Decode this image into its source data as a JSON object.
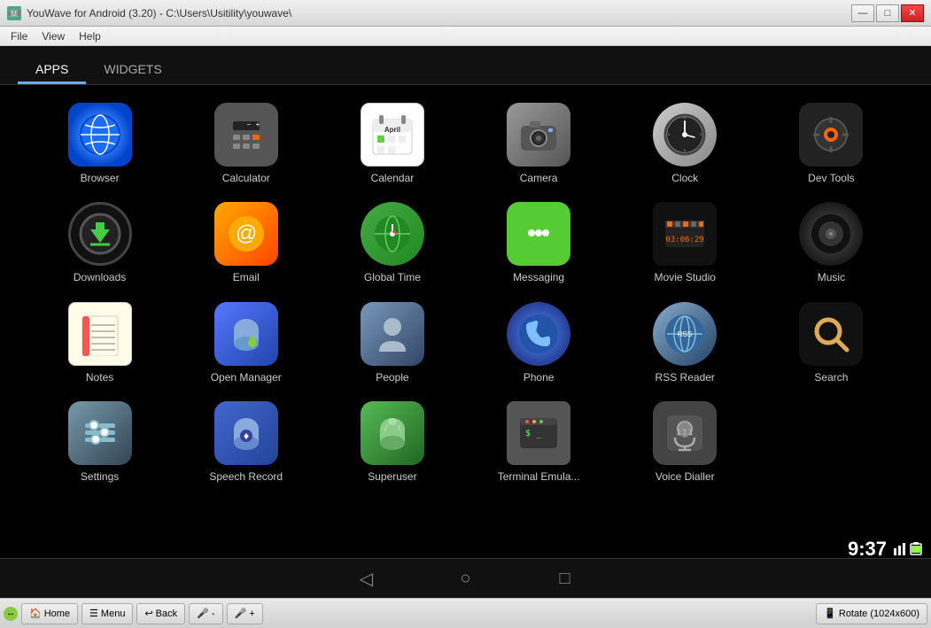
{
  "window": {
    "title": "YouWave for Android (3.20) - C:\\Users\\Usitility\\youwave\\",
    "icon": "🤖",
    "controls": {
      "minimize": "—",
      "maximize": "□",
      "close": "✕"
    }
  },
  "menubar": {
    "items": [
      "File",
      "View",
      "Help"
    ]
  },
  "tabs": [
    {
      "id": "apps",
      "label": "APPS",
      "active": true
    },
    {
      "id": "widgets",
      "label": "WIDGETS",
      "active": false
    }
  ],
  "apps": [
    {
      "id": "browser",
      "label": "Browser",
      "icon": "🌐",
      "iconClass": "icon-browser"
    },
    {
      "id": "calculator",
      "label": "Calculator",
      "icon": "🔢",
      "iconClass": "icon-calculator"
    },
    {
      "id": "calendar",
      "label": "Calendar",
      "icon": "📅",
      "iconClass": "icon-calendar"
    },
    {
      "id": "camera",
      "label": "Camera",
      "icon": "📷",
      "iconClass": "icon-camera"
    },
    {
      "id": "clock",
      "label": "Clock",
      "icon": "🕐",
      "iconClass": "icon-clock"
    },
    {
      "id": "devtools",
      "label": "Dev Tools",
      "icon": "⚙",
      "iconClass": "icon-devtools"
    },
    {
      "id": "downloads",
      "label": "Downloads",
      "icon": "⬇",
      "iconClass": "icon-downloads"
    },
    {
      "id": "email",
      "label": "Email",
      "icon": "✉",
      "iconClass": "icon-email"
    },
    {
      "id": "globaltime",
      "label": "Global Time",
      "icon": "🌍",
      "iconClass": "icon-globaltime"
    },
    {
      "id": "messaging",
      "label": "Messaging",
      "icon": "💬",
      "iconClass": "icon-messaging"
    },
    {
      "id": "moviestudio",
      "label": "Movie Studio",
      "icon": "🎬",
      "iconClass": "icon-moviestudio"
    },
    {
      "id": "music",
      "label": "Music",
      "icon": "🎵",
      "iconClass": "icon-music"
    },
    {
      "id": "notes",
      "label": "Notes",
      "icon": "📝",
      "iconClass": "icon-notes"
    },
    {
      "id": "openmanager",
      "label": "Open Manager",
      "icon": "🤖",
      "iconClass": "icon-openmanager"
    },
    {
      "id": "people",
      "label": "People",
      "icon": "👤",
      "iconClass": "icon-people"
    },
    {
      "id": "phone",
      "label": "Phone",
      "icon": "📞",
      "iconClass": "icon-phone"
    },
    {
      "id": "rssreader",
      "label": "RSS Reader",
      "icon": "🤖",
      "iconClass": "icon-rssreader"
    },
    {
      "id": "search",
      "label": "Search",
      "icon": "🔍",
      "iconClass": "icon-search"
    },
    {
      "id": "settings",
      "label": "Settings",
      "icon": "⚙",
      "iconClass": "icon-settings"
    },
    {
      "id": "speechrecord",
      "label": "Speech Record",
      "icon": "🤖",
      "iconClass": "icon-speechrecord"
    },
    {
      "id": "superuser",
      "label": "Superuser",
      "icon": "🤖",
      "iconClass": "icon-superuser"
    },
    {
      "id": "terminal",
      "label": "Terminal Emula...",
      "icon": "🖥",
      "iconClass": "icon-terminal"
    },
    {
      "id": "voicedialler",
      "label": "Voice Dialler",
      "icon": "🎙",
      "iconClass": "icon-voicedialler"
    }
  ],
  "android_nav": {
    "back": "◁",
    "home": "○",
    "recents": "□"
  },
  "time": "9:37",
  "statusbar": {
    "home_label": "Home",
    "menu_label": "Menu",
    "back_label": "Back",
    "rotate_label": "Rotate (1024x600)"
  }
}
